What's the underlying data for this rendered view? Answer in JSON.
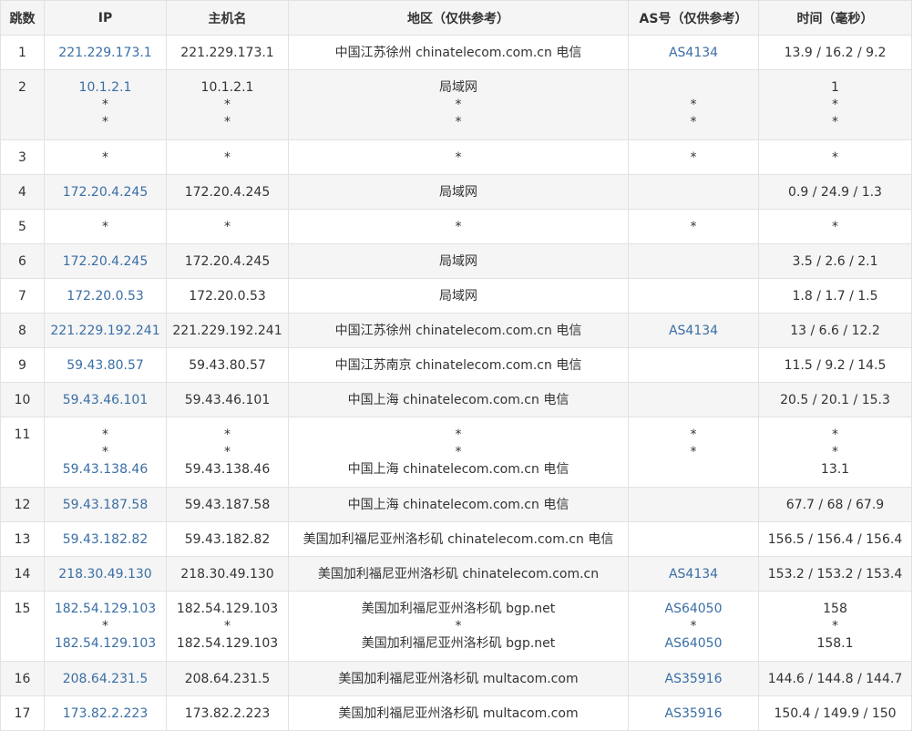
{
  "headers": {
    "hop": "跳数",
    "ip": "IP",
    "hostname": "主机名",
    "region": "地区（仅供参考）",
    "asn": "AS号（仅供参考）",
    "time": "时间（毫秒）"
  },
  "rows": [
    {
      "hop": "1",
      "ip": [
        "221.229.173.1"
      ],
      "host": [
        "221.229.173.1"
      ],
      "region": [
        "中国江苏徐州 chinatelecom.com.cn 电信"
      ],
      "as": [
        "AS4134"
      ],
      "time": [
        "13.9 / 16.2 / 9.2"
      ]
    },
    {
      "hop": "2",
      "ip": [
        "10.1.2.1",
        "*",
        "*"
      ],
      "host": [
        "10.1.2.1",
        "*",
        "*"
      ],
      "region": [
        "局域网",
        "*",
        "*"
      ],
      "as": [
        "",
        "*",
        "*"
      ],
      "time": [
        "1",
        "*",
        "*"
      ]
    },
    {
      "hop": "3",
      "ip": [
        "*"
      ],
      "host": [
        "*"
      ],
      "region": [
        "*"
      ],
      "as": [
        "*"
      ],
      "time": [
        "*"
      ]
    },
    {
      "hop": "4",
      "ip": [
        "172.20.4.245"
      ],
      "host": [
        "172.20.4.245"
      ],
      "region": [
        "局域网"
      ],
      "as": [
        ""
      ],
      "time": [
        "0.9 / 24.9 / 1.3"
      ]
    },
    {
      "hop": "5",
      "ip": [
        "*"
      ],
      "host": [
        "*"
      ],
      "region": [
        "*"
      ],
      "as": [
        "*"
      ],
      "time": [
        "*"
      ]
    },
    {
      "hop": "6",
      "ip": [
        "172.20.4.245"
      ],
      "host": [
        "172.20.4.245"
      ],
      "region": [
        "局域网"
      ],
      "as": [
        ""
      ],
      "time": [
        "3.5 / 2.6 / 2.1"
      ]
    },
    {
      "hop": "7",
      "ip": [
        "172.20.0.53"
      ],
      "host": [
        "172.20.0.53"
      ],
      "region": [
        "局域网"
      ],
      "as": [
        ""
      ],
      "time": [
        "1.8 / 1.7 / 1.5"
      ]
    },
    {
      "hop": "8",
      "ip": [
        "221.229.192.241"
      ],
      "host": [
        "221.229.192.241"
      ],
      "region": [
        "中国江苏徐州 chinatelecom.com.cn 电信"
      ],
      "as": [
        "AS4134"
      ],
      "time": [
        "13 / 6.6 / 12.2"
      ]
    },
    {
      "hop": "9",
      "ip": [
        "59.43.80.57"
      ],
      "host": [
        "59.43.80.57"
      ],
      "region": [
        "中国江苏南京 chinatelecom.com.cn 电信"
      ],
      "as": [
        ""
      ],
      "time": [
        "11.5 / 9.2 / 14.5"
      ]
    },
    {
      "hop": "10",
      "ip": [
        "59.43.46.101"
      ],
      "host": [
        "59.43.46.101"
      ],
      "region": [
        "中国上海 chinatelecom.com.cn 电信"
      ],
      "as": [
        ""
      ],
      "time": [
        "20.5 / 20.1 / 15.3"
      ]
    },
    {
      "hop": "11",
      "ip": [
        "*",
        "*",
        "59.43.138.46"
      ],
      "host": [
        "*",
        "*",
        "59.43.138.46"
      ],
      "region": [
        "*",
        "*",
        "中国上海 chinatelecom.com.cn 电信"
      ],
      "as": [
        "*",
        "*",
        ""
      ],
      "time": [
        "*",
        "*",
        "13.1"
      ]
    },
    {
      "hop": "12",
      "ip": [
        "59.43.187.58"
      ],
      "host": [
        "59.43.187.58"
      ],
      "region": [
        "中国上海 chinatelecom.com.cn 电信"
      ],
      "as": [
        ""
      ],
      "time": [
        "67.7 / 68 / 67.9"
      ]
    },
    {
      "hop": "13",
      "ip": [
        "59.43.182.82"
      ],
      "host": [
        "59.43.182.82"
      ],
      "region": [
        "美国加利福尼亚州洛杉矶 chinatelecom.com.cn 电信"
      ],
      "as": [
        ""
      ],
      "time": [
        "156.5 / 156.4 / 156.4"
      ]
    },
    {
      "hop": "14",
      "ip": [
        "218.30.49.130"
      ],
      "host": [
        "218.30.49.130"
      ],
      "region": [
        "美国加利福尼亚州洛杉矶 chinatelecom.com.cn"
      ],
      "as": [
        "AS4134"
      ],
      "time": [
        "153.2 / 153.2 / 153.4"
      ]
    },
    {
      "hop": "15",
      "ip": [
        "182.54.129.103",
        "*",
        "182.54.129.103"
      ],
      "host": [
        "182.54.129.103",
        "*",
        "182.54.129.103"
      ],
      "region": [
        "美国加利福尼亚州洛杉矶 bgp.net",
        "*",
        "美国加利福尼亚州洛杉矶 bgp.net"
      ],
      "as": [
        "AS64050",
        "*",
        "AS64050"
      ],
      "time": [
        "158",
        "*",
        "158.1"
      ]
    },
    {
      "hop": "16",
      "ip": [
        "208.64.231.5"
      ],
      "host": [
        "208.64.231.5"
      ],
      "region": [
        "美国加利福尼亚州洛杉矶 multacom.com"
      ],
      "as": [
        "AS35916"
      ],
      "time": [
        "144.6 / 144.8 / 144.7"
      ]
    },
    {
      "hop": "17",
      "ip": [
        "173.82.2.223"
      ],
      "host": [
        "173.82.2.223"
      ],
      "region": [
        "美国加利福尼亚州洛杉矶 multacom.com"
      ],
      "as": [
        "AS35916"
      ],
      "time": [
        "150.4 / 149.9 / 150"
      ]
    }
  ],
  "colors": {
    "link": "#3a6ea5",
    "header_bg": "#f5f5f5",
    "stripe_bg": "#f5f5f5",
    "border": "#e2e2e2",
    "text": "#333333"
  }
}
